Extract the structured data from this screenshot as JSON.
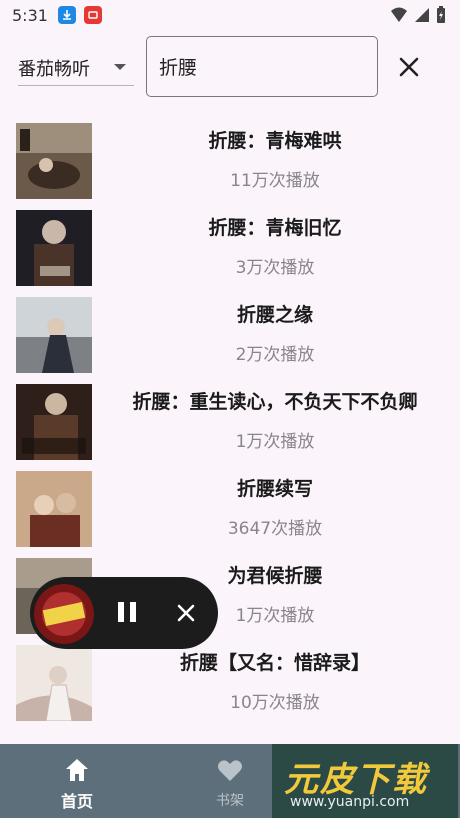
{
  "status_bar": {
    "time": "5:31"
  },
  "search": {
    "source_label": "番茄畅听",
    "query": "折腰"
  },
  "results": [
    {
      "title": "折腰：青梅难哄",
      "plays": "11万次播放"
    },
    {
      "title": "折腰：青梅旧忆",
      "plays": "3万次播放"
    },
    {
      "title": "折腰之缘",
      "plays": "2万次播放"
    },
    {
      "title": "折腰：重生读心，不负天下不负卿",
      "plays": "1万次播放"
    },
    {
      "title": "折腰续写",
      "plays": "3647次播放"
    },
    {
      "title": "为君候折腰",
      "plays": "1万次播放"
    },
    {
      "title": "折腰【又名：惜辞录】",
      "plays": "10万次播放"
    }
  ],
  "nav": {
    "home_label": "首页",
    "shelf_label": "书架"
  },
  "watermark": {
    "title": "元皮下载",
    "url": "www.yuanpi.com"
  },
  "colors": {
    "background": "#fbf4fa",
    "nav_bar": "#5d6f7a",
    "player": "#1c1c1c",
    "watermark_yellow": "#f2c93b"
  },
  "icons": [
    "download-icon",
    "app-icon",
    "wifi-icon",
    "signal-icon",
    "battery-icon",
    "chevron-down-icon",
    "close-icon",
    "pause-icon",
    "home-icon",
    "heart-icon"
  ]
}
